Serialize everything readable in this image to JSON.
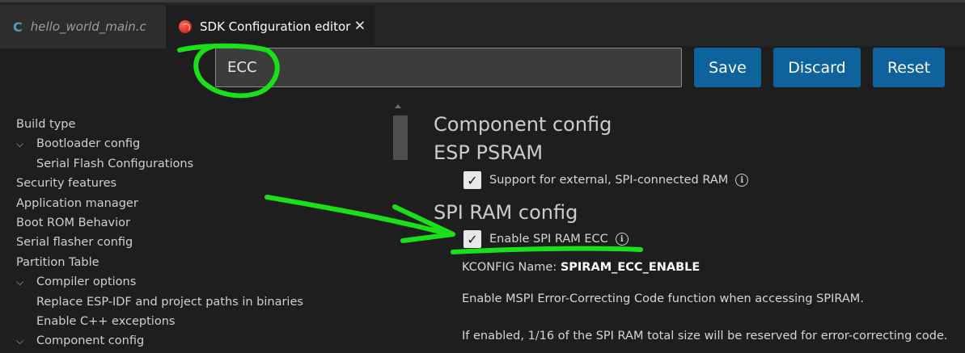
{
  "tabs": [
    {
      "label": "hello_world_main.c",
      "icon": "c-file-icon",
      "active": false
    },
    {
      "label": "SDK Configuration editor",
      "icon": "esp-idf-icon",
      "active": true
    }
  ],
  "search": {
    "value": "ECC"
  },
  "toolbar": {
    "save_label": "Save",
    "discard_label": "Discard",
    "reset_label": "Reset"
  },
  "sidebar": {
    "items": [
      {
        "label": "Build type",
        "level": 0
      },
      {
        "label": "Bootloader config",
        "level": 0,
        "expanded": true
      },
      {
        "label": "Serial Flash Configurations",
        "level": 1
      },
      {
        "label": "Security features",
        "level": 0
      },
      {
        "label": "Application manager",
        "level": 0
      },
      {
        "label": "Boot ROM Behavior",
        "level": 0
      },
      {
        "label": "Serial flasher config",
        "level": 0
      },
      {
        "label": "Partition Table",
        "level": 0
      },
      {
        "label": "Compiler options",
        "level": 0,
        "expanded": true
      },
      {
        "label": "Replace ESP-IDF and project paths in binaries",
        "level": 1
      },
      {
        "label": "Enable C++ exceptions",
        "level": 1
      },
      {
        "label": "Component config",
        "level": 0,
        "expanded": true
      }
    ]
  },
  "content": {
    "heading_component": "Component config",
    "heading_psram": "ESP PSRAM",
    "option_psram": {
      "label": "Support for external, SPI-connected RAM",
      "checked": true
    },
    "heading_spiram": "SPI RAM config",
    "option_ecc": {
      "label": "Enable SPI RAM ECC",
      "checked": true
    },
    "kconfig_label": "KCONFIG Name:",
    "kconfig_value": "SPIRAM_ECC_ENABLE",
    "description_1": "Enable MSPI Error-Correcting Code function when accessing SPIRAM.",
    "description_2": "If enabled, 1/16 of the SPI RAM total size will be reserved for error-correcting code."
  },
  "glyphs": {
    "check": "✓",
    "close": "✕",
    "chevron": "⌵",
    "info": "i",
    "c_letter": "C"
  },
  "colors": {
    "accent_button": "#0e639c",
    "annotation": "#19e019",
    "background": "#1e1e1e"
  }
}
